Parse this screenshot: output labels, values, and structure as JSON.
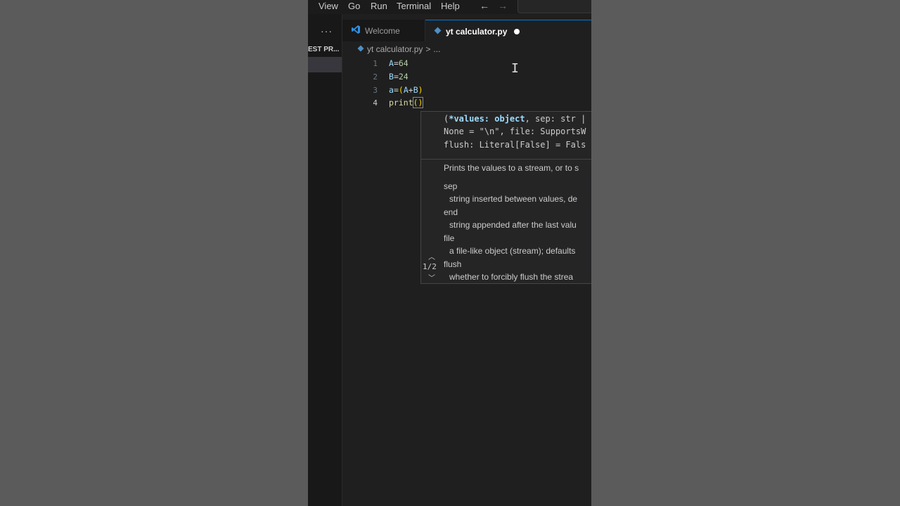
{
  "menu": {
    "items": [
      "View",
      "Go",
      "Run",
      "Terminal",
      "Help"
    ],
    "back_arrow": "←",
    "forward_arrow": "→"
  },
  "explorer": {
    "more": "···",
    "section_label": "EST PR..."
  },
  "tabs": [
    {
      "label": "Welcome",
      "icon": "vscode-icon"
    },
    {
      "label": "yt calculator.py",
      "icon": "python-file-icon",
      "dirty": true
    }
  ],
  "breadcrumb": {
    "file": "yt calculator.py",
    "separator": ">",
    "tail": "..."
  },
  "editor": {
    "lines": [
      {
        "number": "1",
        "code": "A=64"
      },
      {
        "number": "2",
        "code": "B=24"
      },
      {
        "number": "3",
        "code": "a=(A+B)"
      },
      {
        "number": "4",
        "code": "print()"
      }
    ],
    "active_line": 4
  },
  "signature_help": {
    "sig_lines": [
      "(*values: object, sep: str |",
      "None = \"\\n\", file: SupportsW",
      "flush: Literal[False] = Fals"
    ],
    "description": "Prints the values to a stream, or to s",
    "params": [
      {
        "name": "sep",
        "desc": "string inserted between values, de"
      },
      {
        "name": "end",
        "desc": "string appended after the last valu"
      },
      {
        "name": "file",
        "desc": "a file-like object (stream); defaults"
      },
      {
        "name": "flush",
        "desc": "whether to forcibly flush the strea"
      }
    ],
    "pager": "1/2"
  }
}
